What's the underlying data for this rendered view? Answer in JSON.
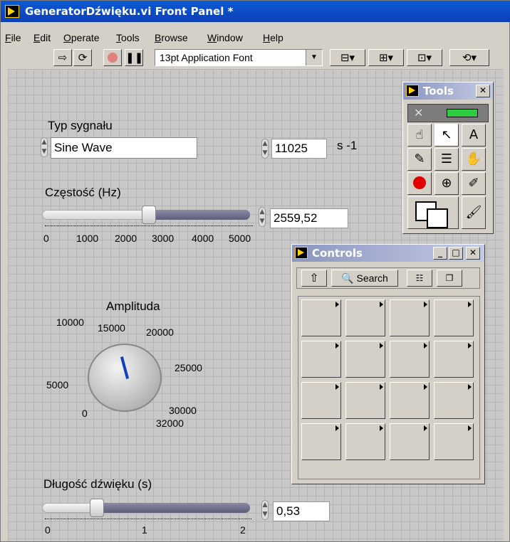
{
  "window": {
    "title": "GeneratorDźwięku.vi Front Panel *"
  },
  "menu": [
    "File",
    "Edit",
    "Operate",
    "Tools",
    "Browse",
    "Window",
    "Help"
  ],
  "toolbar": {
    "font": "13pt Application Font"
  },
  "controls": {
    "signal_type": {
      "label": "Typ sygnału",
      "value": "Sine Wave"
    },
    "sample_rate": {
      "value": "11025",
      "unit": "s -1"
    },
    "frequency": {
      "label": "Częstość (Hz)",
      "value": "2559,52",
      "ticks": [
        "0",
        "1000",
        "2000",
        "3000",
        "4000",
        "5000"
      ],
      "fraction": 0.512
    },
    "amplitude": {
      "label": "Amplituda",
      "ticks": [
        "0",
        "5000",
        "10000",
        "15000",
        "20000",
        "25000",
        "30000",
        "32000"
      ]
    },
    "duration": {
      "label": "Długość dźwięku (s)",
      "value": "0,53",
      "ticks": [
        "0",
        "1",
        "2"
      ],
      "fraction": 0.265
    }
  },
  "tools_palette": {
    "title": "Tools"
  },
  "controls_palette": {
    "title": "Controls",
    "search_label": "Search"
  }
}
